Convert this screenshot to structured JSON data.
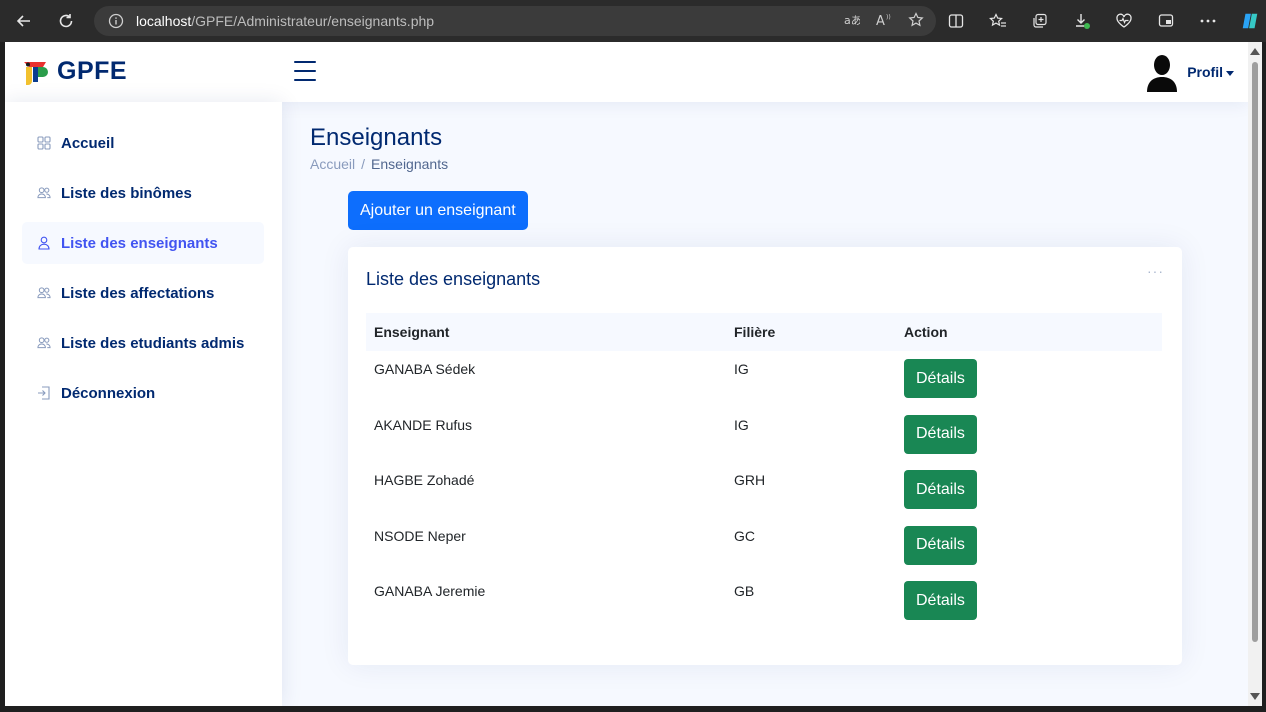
{
  "browser": {
    "url_host": "localhost",
    "url_path": "/GPFE/Administrateur/enseignants.php"
  },
  "header": {
    "logo_text": "GPFE",
    "profile_label": "Profil"
  },
  "sidebar": {
    "items": [
      {
        "label": "Accueil",
        "icon": "grid-icon"
      },
      {
        "label": "Liste des binômes",
        "icon": "people-icon"
      },
      {
        "label": "Liste des enseignants",
        "icon": "person-icon"
      },
      {
        "label": "Liste des affectations",
        "icon": "people-icon"
      },
      {
        "label": "Liste des etudiants admis",
        "icon": "people-icon"
      },
      {
        "label": "Déconnexion",
        "icon": "logout-icon"
      }
    ]
  },
  "main": {
    "page_title": "Enseignants",
    "breadcrumb": {
      "home": "Accueil",
      "separator": "/",
      "current": "Enseignants"
    },
    "add_button": "Ajouter un enseignant",
    "card": {
      "title": "Liste des enseignants",
      "menu": "···",
      "columns": [
        "Enseignant",
        "Filière",
        "Action"
      ],
      "rows": [
        {
          "enseignant": "GANABA Sédek",
          "filiere": "IG",
          "action": "Détails"
        },
        {
          "enseignant": "AKANDE Rufus",
          "filiere": "IG",
          "action": "Détails"
        },
        {
          "enseignant": "HAGBE Zohadé",
          "filiere": "GRH",
          "action": "Détails"
        },
        {
          "enseignant": "NSODE Neper",
          "filiere": "GC",
          "action": "Détails"
        },
        {
          "enseignant": "GANABA Jeremie",
          "filiere": "GB",
          "action": "Détails"
        }
      ]
    }
  },
  "colors": {
    "primary_navy": "#012970",
    "active_blue": "#4154f1",
    "button_blue": "#0d6efd",
    "button_green": "#198754",
    "page_bg": "#f6f9ff"
  }
}
